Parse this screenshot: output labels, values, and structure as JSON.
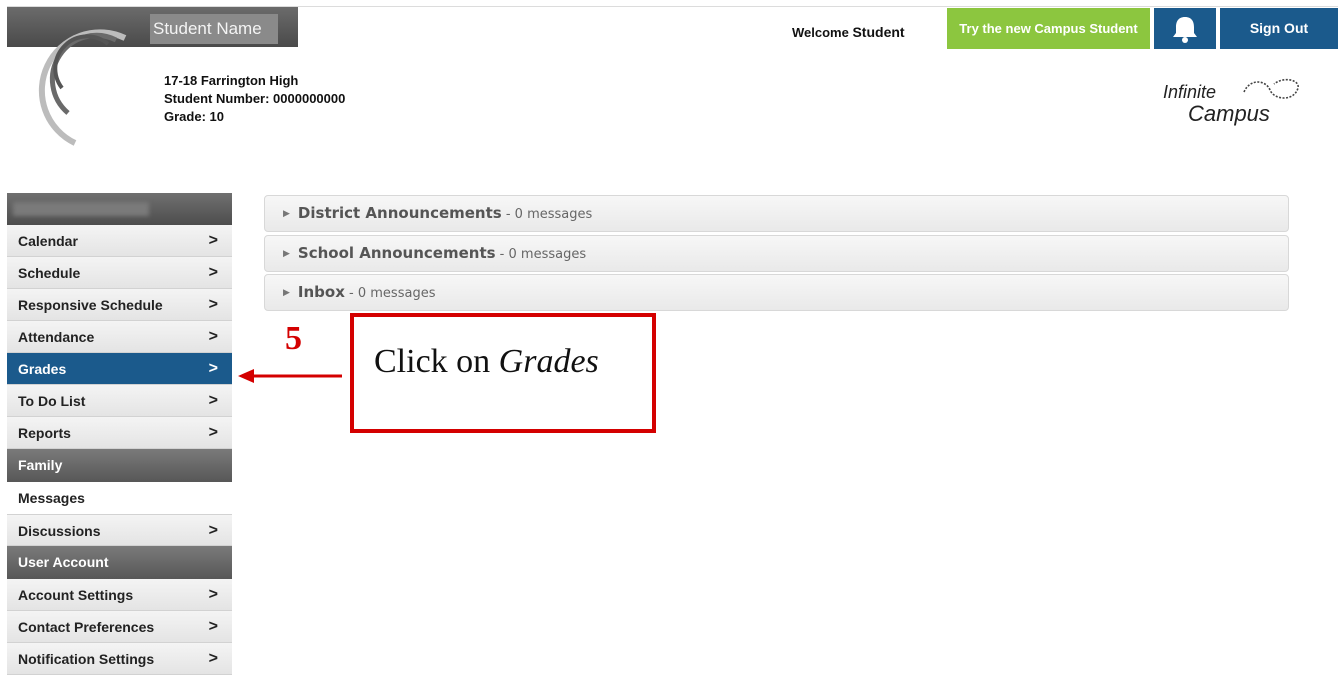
{
  "header": {
    "student_name": "Student Name",
    "school_year_school": "17-18 Farrington High",
    "student_number": "Student Number: 0000000000",
    "grade": "Grade: 10",
    "welcome_label": "Welcome",
    "welcome_name": "Student",
    "try_new_label": "Try the new Campus Student",
    "sign_out_label": "Sign Out",
    "logo_word_1": "Infinite",
    "logo_word_2": "Campus"
  },
  "sidebar": {
    "items": [
      {
        "label": "Calendar"
      },
      {
        "label": "Schedule"
      },
      {
        "label": "Responsive Schedule"
      },
      {
        "label": "Attendance"
      },
      {
        "label": "Grades"
      },
      {
        "label": "To Do List"
      },
      {
        "label": "Reports"
      }
    ],
    "family_section": "Family",
    "family_items": [
      {
        "label": "Messages"
      },
      {
        "label": "Discussions"
      }
    ],
    "account_section": "User Account",
    "account_items": [
      {
        "label": "Account Settings"
      },
      {
        "label": "Contact Preferences"
      },
      {
        "label": "Notification Settings"
      }
    ]
  },
  "announcements": [
    {
      "title": "District Announcements",
      "count": " - 0 messages"
    },
    {
      "title": "School Announcements",
      "count": " - 0 messages"
    },
    {
      "title": "Inbox",
      "count": " - 0 messages"
    }
  ],
  "callout": {
    "step": "5",
    "text_prefix": "Click on ",
    "text_emphasis": "Grades"
  },
  "colors": {
    "accent_blue": "#1b5a8c",
    "try_green": "#8cc63f",
    "annotation_red": "#d40000"
  },
  "icons": {
    "bell": "bell-icon",
    "chevron": "chevron-right-icon"
  }
}
